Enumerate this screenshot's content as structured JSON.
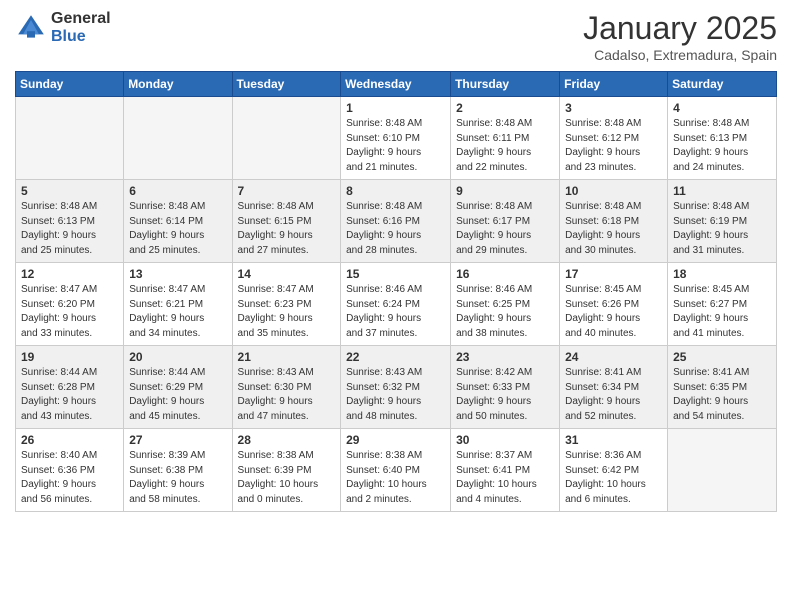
{
  "logo": {
    "general": "General",
    "blue": "Blue"
  },
  "header": {
    "month": "January 2025",
    "location": "Cadalso, Extremadura, Spain"
  },
  "weekdays": [
    "Sunday",
    "Monday",
    "Tuesday",
    "Wednesday",
    "Thursday",
    "Friday",
    "Saturday"
  ],
  "weeks": [
    {
      "shaded": false,
      "days": [
        {
          "num": "",
          "info": ""
        },
        {
          "num": "",
          "info": ""
        },
        {
          "num": "",
          "info": ""
        },
        {
          "num": "1",
          "info": "Sunrise: 8:48 AM\nSunset: 6:10 PM\nDaylight: 9 hours\nand 21 minutes."
        },
        {
          "num": "2",
          "info": "Sunrise: 8:48 AM\nSunset: 6:11 PM\nDaylight: 9 hours\nand 22 minutes."
        },
        {
          "num": "3",
          "info": "Sunrise: 8:48 AM\nSunset: 6:12 PM\nDaylight: 9 hours\nand 23 minutes."
        },
        {
          "num": "4",
          "info": "Sunrise: 8:48 AM\nSunset: 6:13 PM\nDaylight: 9 hours\nand 24 minutes."
        }
      ]
    },
    {
      "shaded": true,
      "days": [
        {
          "num": "5",
          "info": "Sunrise: 8:48 AM\nSunset: 6:13 PM\nDaylight: 9 hours\nand 25 minutes."
        },
        {
          "num": "6",
          "info": "Sunrise: 8:48 AM\nSunset: 6:14 PM\nDaylight: 9 hours\nand 25 minutes."
        },
        {
          "num": "7",
          "info": "Sunrise: 8:48 AM\nSunset: 6:15 PM\nDaylight: 9 hours\nand 27 minutes."
        },
        {
          "num": "8",
          "info": "Sunrise: 8:48 AM\nSunset: 6:16 PM\nDaylight: 9 hours\nand 28 minutes."
        },
        {
          "num": "9",
          "info": "Sunrise: 8:48 AM\nSunset: 6:17 PM\nDaylight: 9 hours\nand 29 minutes."
        },
        {
          "num": "10",
          "info": "Sunrise: 8:48 AM\nSunset: 6:18 PM\nDaylight: 9 hours\nand 30 minutes."
        },
        {
          "num": "11",
          "info": "Sunrise: 8:48 AM\nSunset: 6:19 PM\nDaylight: 9 hours\nand 31 minutes."
        }
      ]
    },
    {
      "shaded": false,
      "days": [
        {
          "num": "12",
          "info": "Sunrise: 8:47 AM\nSunset: 6:20 PM\nDaylight: 9 hours\nand 33 minutes."
        },
        {
          "num": "13",
          "info": "Sunrise: 8:47 AM\nSunset: 6:21 PM\nDaylight: 9 hours\nand 34 minutes."
        },
        {
          "num": "14",
          "info": "Sunrise: 8:47 AM\nSunset: 6:23 PM\nDaylight: 9 hours\nand 35 minutes."
        },
        {
          "num": "15",
          "info": "Sunrise: 8:46 AM\nSunset: 6:24 PM\nDaylight: 9 hours\nand 37 minutes."
        },
        {
          "num": "16",
          "info": "Sunrise: 8:46 AM\nSunset: 6:25 PM\nDaylight: 9 hours\nand 38 minutes."
        },
        {
          "num": "17",
          "info": "Sunrise: 8:45 AM\nSunset: 6:26 PM\nDaylight: 9 hours\nand 40 minutes."
        },
        {
          "num": "18",
          "info": "Sunrise: 8:45 AM\nSunset: 6:27 PM\nDaylight: 9 hours\nand 41 minutes."
        }
      ]
    },
    {
      "shaded": true,
      "days": [
        {
          "num": "19",
          "info": "Sunrise: 8:44 AM\nSunset: 6:28 PM\nDaylight: 9 hours\nand 43 minutes."
        },
        {
          "num": "20",
          "info": "Sunrise: 8:44 AM\nSunset: 6:29 PM\nDaylight: 9 hours\nand 45 minutes."
        },
        {
          "num": "21",
          "info": "Sunrise: 8:43 AM\nSunset: 6:30 PM\nDaylight: 9 hours\nand 47 minutes."
        },
        {
          "num": "22",
          "info": "Sunrise: 8:43 AM\nSunset: 6:32 PM\nDaylight: 9 hours\nand 48 minutes."
        },
        {
          "num": "23",
          "info": "Sunrise: 8:42 AM\nSunset: 6:33 PM\nDaylight: 9 hours\nand 50 minutes."
        },
        {
          "num": "24",
          "info": "Sunrise: 8:41 AM\nSunset: 6:34 PM\nDaylight: 9 hours\nand 52 minutes."
        },
        {
          "num": "25",
          "info": "Sunrise: 8:41 AM\nSunset: 6:35 PM\nDaylight: 9 hours\nand 54 minutes."
        }
      ]
    },
    {
      "shaded": false,
      "days": [
        {
          "num": "26",
          "info": "Sunrise: 8:40 AM\nSunset: 6:36 PM\nDaylight: 9 hours\nand 56 minutes."
        },
        {
          "num": "27",
          "info": "Sunrise: 8:39 AM\nSunset: 6:38 PM\nDaylight: 9 hours\nand 58 minutes."
        },
        {
          "num": "28",
          "info": "Sunrise: 8:38 AM\nSunset: 6:39 PM\nDaylight: 10 hours\nand 0 minutes."
        },
        {
          "num": "29",
          "info": "Sunrise: 8:38 AM\nSunset: 6:40 PM\nDaylight: 10 hours\nand 2 minutes."
        },
        {
          "num": "30",
          "info": "Sunrise: 8:37 AM\nSunset: 6:41 PM\nDaylight: 10 hours\nand 4 minutes."
        },
        {
          "num": "31",
          "info": "Sunrise: 8:36 AM\nSunset: 6:42 PM\nDaylight: 10 hours\nand 6 minutes."
        },
        {
          "num": "",
          "info": ""
        }
      ]
    }
  ]
}
